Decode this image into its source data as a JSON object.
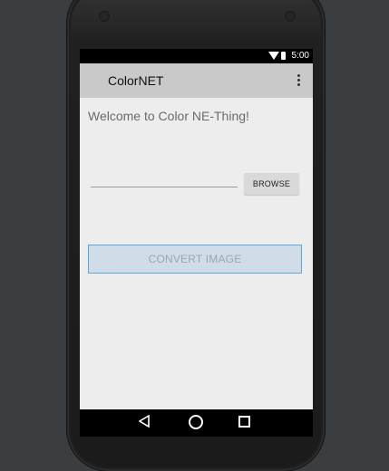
{
  "status_bar": {
    "time": "5:00"
  },
  "app_bar": {
    "title": "ColorNET"
  },
  "main": {
    "welcome_text": "Welcome to Color NE-Thing!",
    "file_input": {
      "value": "",
      "placeholder": ""
    },
    "browse_label": "BROWSE",
    "convert_label": "CONVERT IMAGE"
  },
  "colors": {
    "background": "#3a3d40",
    "screen": "#ededed",
    "app_bar": "#c9c9c9",
    "status_bar": "#000000",
    "convert_fill": "#d0dde8",
    "convert_border": "#57a7e0",
    "convert_text": "#98a7b3"
  },
  "icons": {
    "wifi": "wifi-icon",
    "battery": "battery-icon",
    "overflow": "more-vert-icon",
    "back": "back-icon",
    "home": "home-icon",
    "recents": "recents-icon"
  }
}
